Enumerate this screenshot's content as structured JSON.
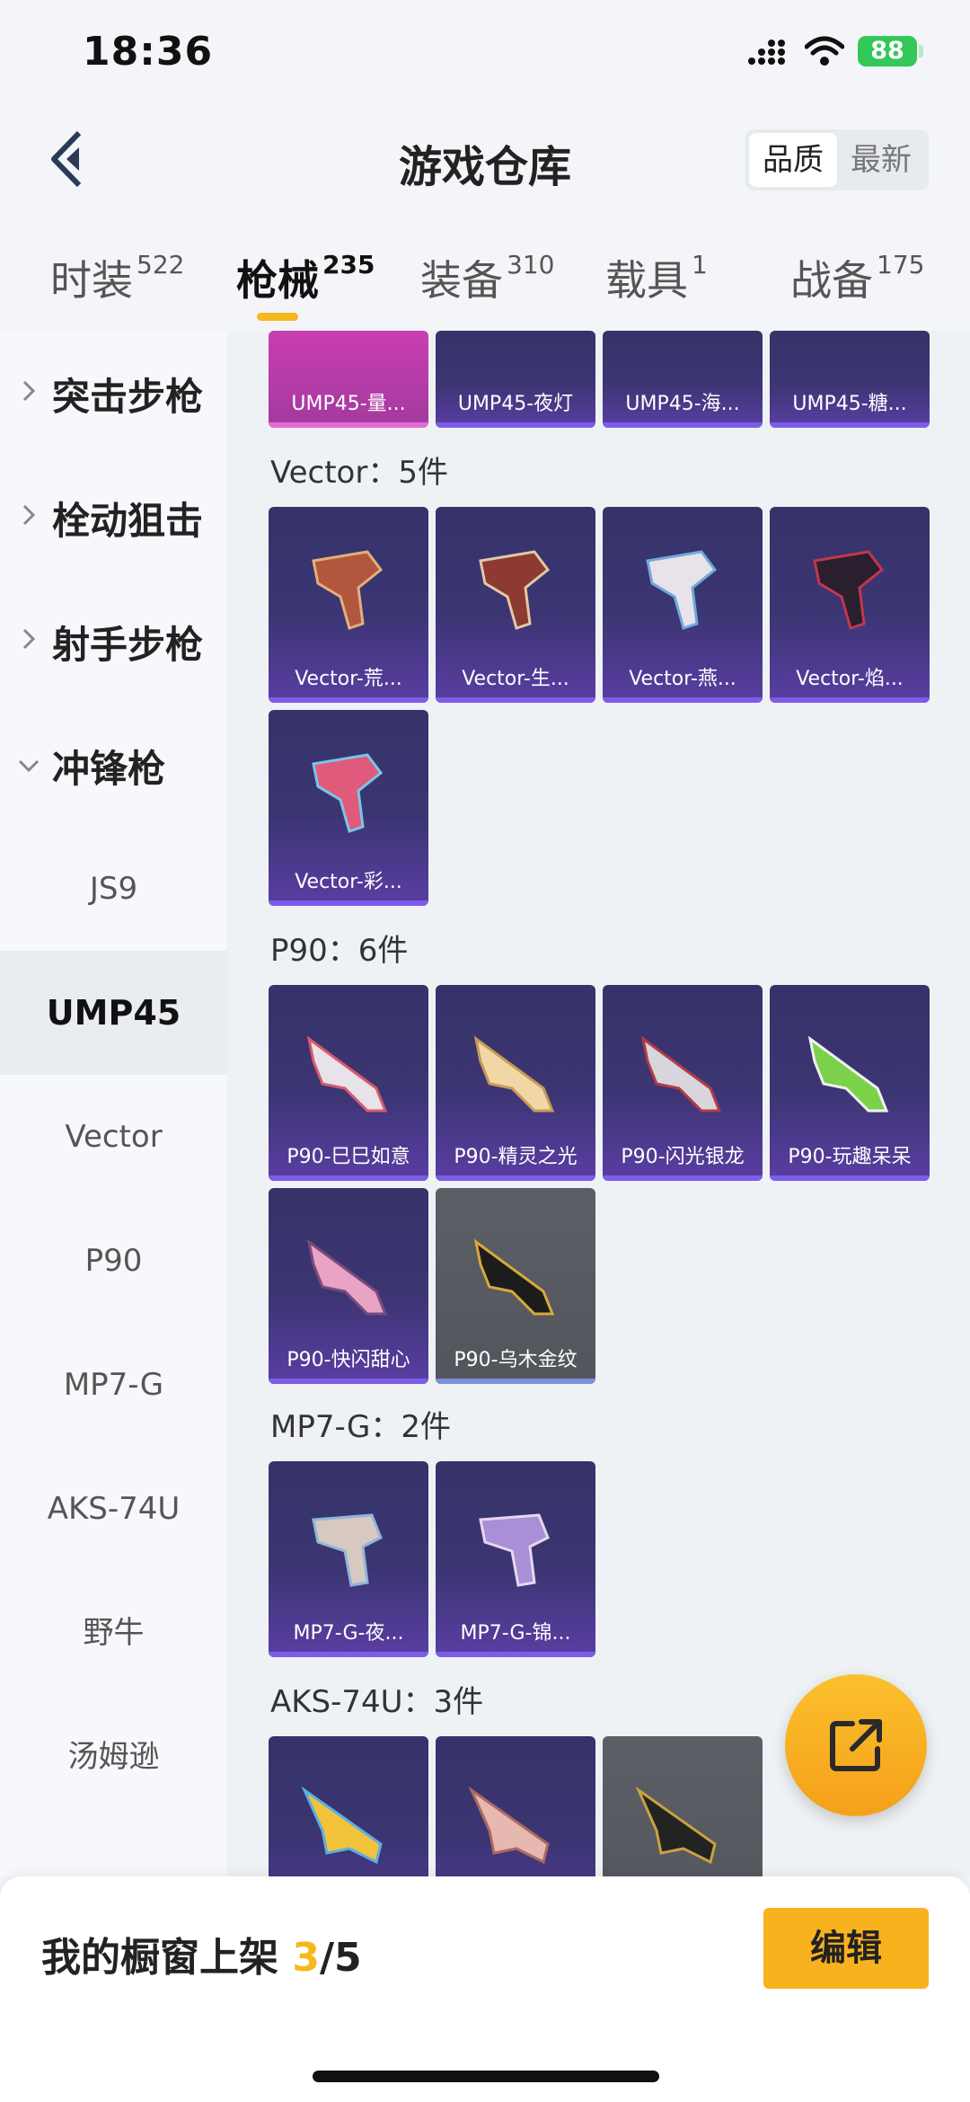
{
  "status_bar": {
    "time": "18:36",
    "battery": "88"
  },
  "header": {
    "title": "游戏仓库",
    "sort_options": [
      "品质",
      "最新"
    ]
  },
  "tabs": [
    {
      "label": "时装",
      "count": "522"
    },
    {
      "label": "枪械",
      "count": "235"
    },
    {
      "label": "装备",
      "count": "310"
    },
    {
      "label": "载具",
      "count": "1"
    },
    {
      "label": "战备",
      "count": "175"
    }
  ],
  "sidebar": {
    "categories": [
      {
        "label": "突击步枪"
      },
      {
        "label": "栓动狙击"
      },
      {
        "label": "射手步枪"
      },
      {
        "label": "冲锋枪"
      }
    ],
    "subcategories": [
      "JS9",
      "UMP45",
      "Vector",
      "P90",
      "MP7-G",
      "AKS-74U",
      "野牛",
      "汤姆逊"
    ]
  },
  "content": {
    "ump45_row": [
      "UMP45-量...",
      "UMP45-夜灯",
      "UMP45-海...",
      "UMP45-糖..."
    ],
    "groups": [
      {
        "title": "Vector：5件",
        "items": [
          "Vector-荒...",
          "Vector-生...",
          "Vector-燕...",
          "Vector-焰...",
          "Vector-彩..."
        ]
      },
      {
        "title": "P90：6件",
        "items": [
          "P90-巳巳如意",
          "P90-精灵之光",
          "P90-闪光银龙",
          "P90-玩趣呆呆",
          "P90-快闪甜心",
          "P90-乌木金纹"
        ]
      },
      {
        "title": "MP7-G：2件",
        "items": [
          "MP7-G-夜...",
          "MP7-G-锦..."
        ]
      },
      {
        "title": "AKS-74U：3件",
        "items": []
      }
    ]
  },
  "bottom_bar": {
    "label": "我的橱窗上架 ",
    "count": "3",
    "total": "/5",
    "edit_label": "编辑"
  },
  "colors": {
    "accent": "#f5b81d",
    "card_purple": "#3c3573",
    "card_gray": "#55575e"
  }
}
